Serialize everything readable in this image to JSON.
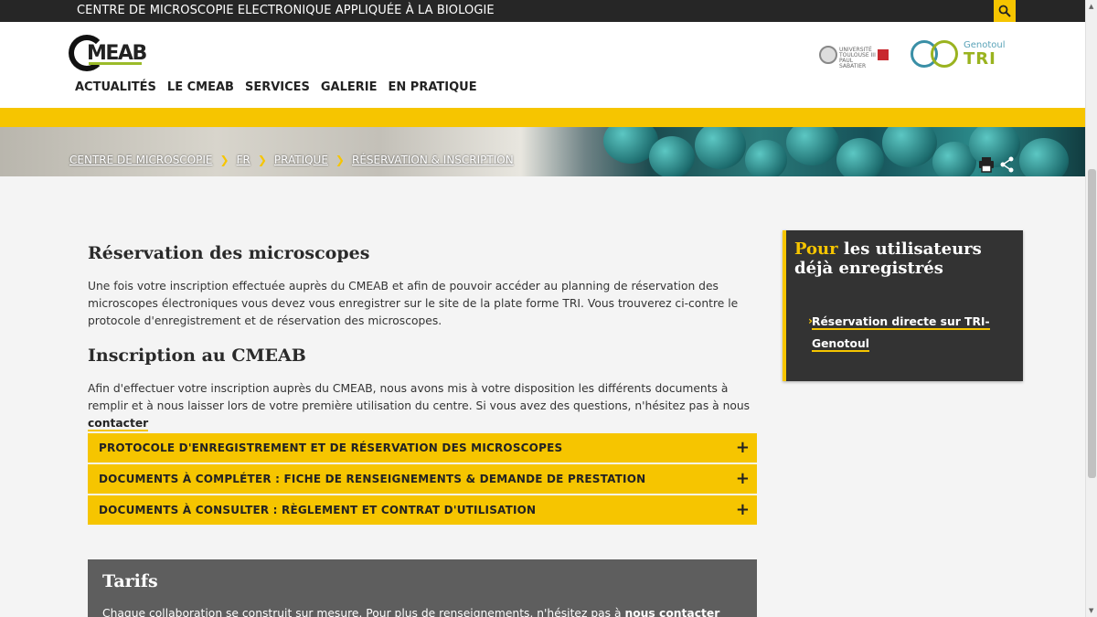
{
  "topbar": {
    "title": "CENTRE DE MICROSCOPIE ELECTRONIQUE APPLIQUÉE À LA BIOLOGIE"
  },
  "logo": {
    "text": "MEAB"
  },
  "nav": [
    "ACTUALITÉS",
    "LE CMEAB",
    "SERVICES",
    "GALERIE",
    "EN PRATIQUE"
  ],
  "partner_logos": {
    "ut_text": "UNIVERSITÉ TOULOUSE III PAUL SABATIER",
    "tri_top": "Genotoul",
    "tri_main": "TRI"
  },
  "breadcrumb": [
    "CENTRE DE MICROSCOPIE",
    "FR",
    "PRATIQUE",
    "RÉSERVATION & INSCRIPTION"
  ],
  "breadcrumb_separator": "❯",
  "main": {
    "reservation_title": "Réservation des microscopes",
    "reservation_text": "Une fois votre inscription effectuée auprès du CMEAB et afin de pouvoir accéder au planning de réservation des microscopes électroniques vous devez vous enregistrer sur le site de la plate forme TRI. Vous trouverez ci-contre le protocole d'enregistrement et de réservation des microscopes.",
    "inscription_title": "Inscription au CMEAB",
    "inscription_text": "Afin d'effectuer votre inscription auprès du CMEAB, nous avons mis à votre disposition les différents documents à remplir et à nous laisser lors de votre première utilisation du centre. Si vous avez des questions, n'hésitez pas à nous",
    "contact_link": "contacter",
    "accordions": [
      "PROTOCOLE D'ENREGISTREMENT ET DE RÉSERVATION DES MICROSCOPES",
      "DOCUMENTS À COMPLÉTER : FICHE DE RENSEIGNEMENTS & DEMANDE DE PRESTATION",
      "DOCUMENTS À CONSULTER : RÈGLEMENT ET CONTRAT D'UTILISATION"
    ],
    "accordion_icon": "+",
    "tarifs_title": "Tarifs",
    "tarifs_text": "Chaque collaboration se construit sur mesure. Pour plus de renseignements, n'hésitez pas à",
    "tarifs_link": "nous contacter"
  },
  "sidebar": {
    "title_highlight": "Pour",
    "title_rest": " les utilisateurs déjà enregistrés",
    "link_chevron": "›",
    "link": "Réservation directe sur TRI-Genotoul"
  },
  "scrollbar": {
    "up": "▲",
    "down": "▼"
  },
  "colors": {
    "accent": "#f6c500",
    "dark": "#262626",
    "panel": "#333333",
    "tarifs_bg": "#5e5e5e"
  },
  "icons": [
    "search-icon",
    "print-icon",
    "share-icon"
  ]
}
